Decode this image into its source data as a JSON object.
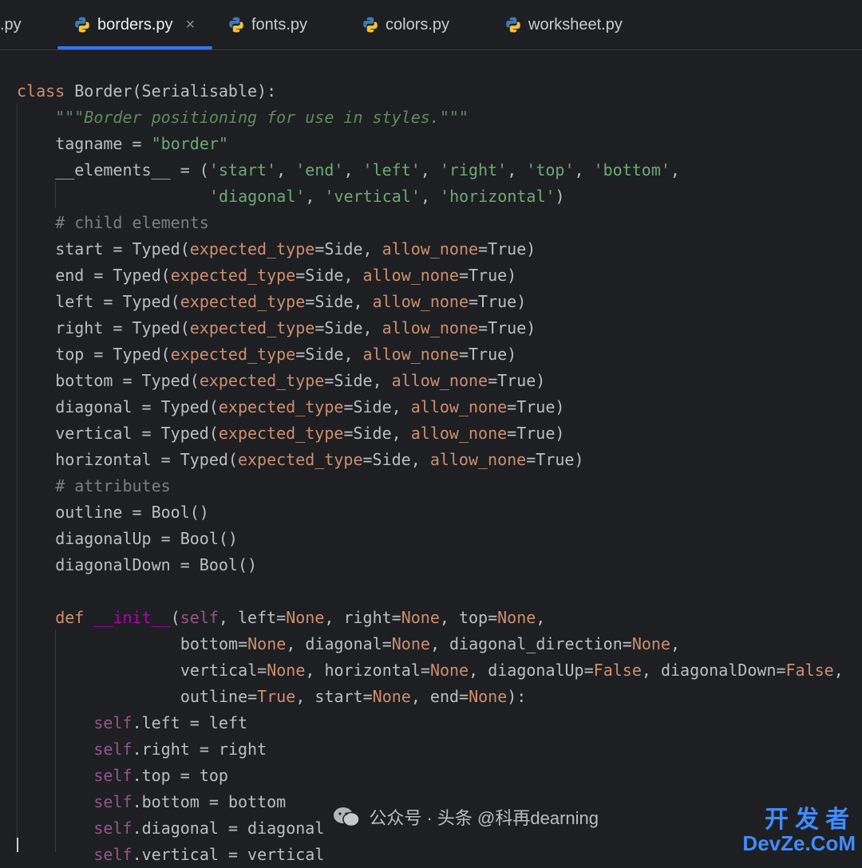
{
  "tabs": [
    {
      "label": ".py",
      "active": false
    },
    {
      "label": "borders.py",
      "active": true,
      "close": "×"
    },
    {
      "label": "fonts.py",
      "active": false
    },
    {
      "label": "colors.py",
      "active": false
    },
    {
      "label": "worksheet.py",
      "active": false
    }
  ],
  "code": {
    "l1": {
      "kw": "class",
      "rest": " Border(Serialisable):"
    },
    "l2": {
      "doc": "\"\"\"Border positioning for use in styles.\"\"\""
    },
    "l3": {
      "a": "tagname = ",
      "s": "\"border\""
    },
    "l4": {
      "a": "__elements__ = (",
      "s1": "'start'",
      "s2": "'end'",
      "s3": "'left'",
      "s4": "'right'",
      "s5": "'top'",
      "s6": "'bottom'",
      "tail": ","
    },
    "l5": {
      "s1": "'diagonal'",
      "s2": "'vertical'",
      "s3": "'horizontal'",
      "tail": ")"
    },
    "l6": {
      "comment": "# child elements"
    },
    "fields": [
      {
        "name": "start"
      },
      {
        "name": "end"
      },
      {
        "name": "left"
      },
      {
        "name": "right"
      },
      {
        "name": "top"
      },
      {
        "name": "bottom"
      },
      {
        "name": "diagonal"
      },
      {
        "name": "vertical"
      },
      {
        "name": "horizontal"
      }
    ],
    "typed_call": "Typed(",
    "arg1": "expected_type",
    "val1": "=Side, ",
    "arg2": "allow_none",
    "val2": "=True)",
    "l16": {
      "comment": "# attributes"
    },
    "l17": "outline = Bool()",
    "l18": "diagonalUp = Bool()",
    "l19": "diagonalDown = Bool()",
    "def_kw": "def",
    "init_name": "__init__",
    "self": "self",
    "none": "None",
    "false": "False",
    "true": "True",
    "assigns": [
      {
        "attr": ".left = left"
      },
      {
        "attr": ".right = right"
      },
      {
        "attr": ".top = top"
      },
      {
        "attr": ".bottom = bottom"
      },
      {
        "attr": ".diagonal = diagonal"
      },
      {
        "attr": ".vertical = vertical"
      }
    ]
  },
  "watermark": {
    "text": "公众号 · 头条 @科再dearning",
    "site_cn": "开发者",
    "site_en": "DevZe.CoM"
  }
}
